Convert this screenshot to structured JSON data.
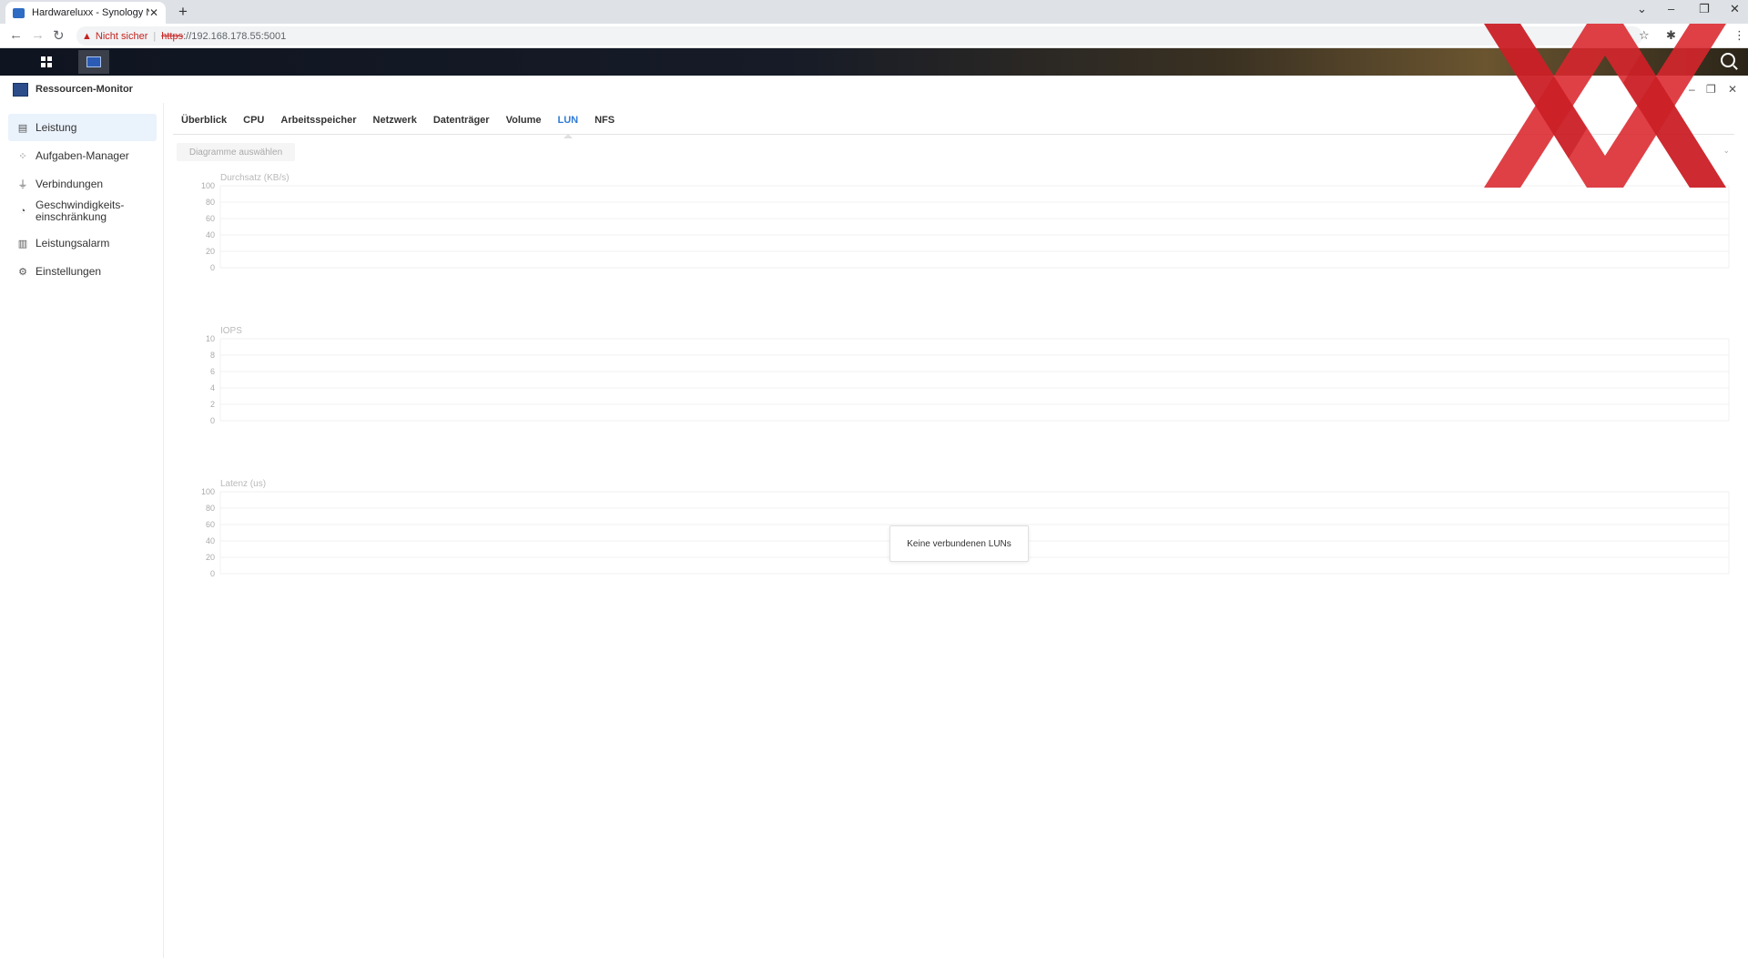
{
  "browser": {
    "tab_title": "Hardwareluxx - Synology NAS",
    "tab_close": "✕",
    "new_tab": "+",
    "not_secure": "Nicht sicher",
    "url_scheme": "https",
    "url_rest": "://192.168.178.55:5001"
  },
  "app": {
    "title": "Ressourcen-Monitor"
  },
  "sidebar": {
    "items": [
      {
        "label": "Leistung",
        "icon": "chart-icon"
      },
      {
        "label": "Aufgaben-Manager",
        "icon": "tasks-icon"
      },
      {
        "label": "Verbindungen",
        "icon": "plug-icon"
      },
      {
        "label": "Geschwindigkeits-",
        "label2": "einschränkung",
        "icon": "gauge-icon"
      },
      {
        "label": "Leistungsalarm",
        "icon": "alarm-icon"
      },
      {
        "label": "Einstellungen",
        "icon": "gear-icon"
      }
    ]
  },
  "tabs": [
    "Überblick",
    "CPU",
    "Arbeitsspeicher",
    "Netzwerk",
    "Datenträger",
    "Volume",
    "LUN",
    "NFS"
  ],
  "toolbar": {
    "select_charts": "Diagramme auswählen"
  },
  "charts": {
    "throughput": {
      "title": "Durchsatz (KB/s)",
      "ticks": [
        "100",
        "80",
        "60",
        "40",
        "20",
        "0"
      ]
    },
    "iops": {
      "title": "IOPS",
      "ticks": [
        "10",
        "8",
        "6",
        "4",
        "2",
        "0"
      ]
    },
    "latency": {
      "title": "Latenz (us)",
      "ticks": [
        "100",
        "80",
        "60",
        "40",
        "20",
        "0"
      ]
    }
  },
  "toast": {
    "message": "Keine verbundenen LUNs"
  },
  "colors": {
    "accent": "#2f7bd5",
    "logo_red": "#d9262c"
  }
}
